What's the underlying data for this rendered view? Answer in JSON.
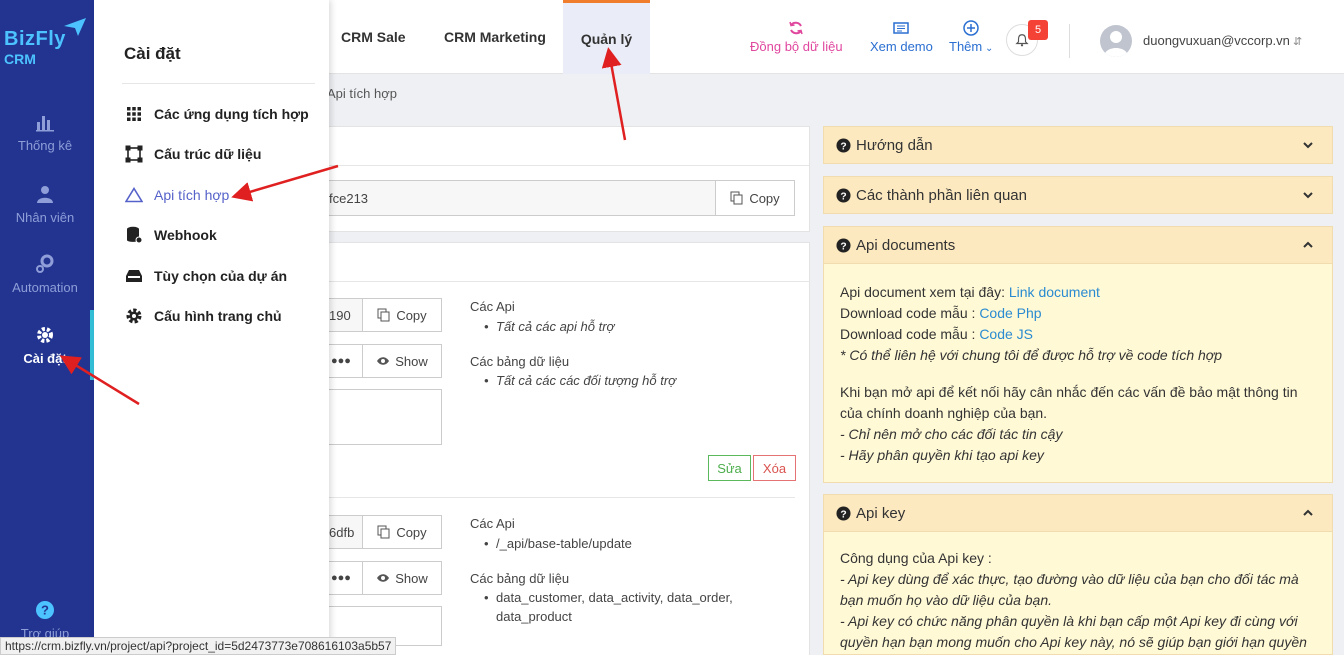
{
  "logo": {
    "line1": "BizFly",
    "line2": "CRM"
  },
  "rail": {
    "items": [
      {
        "label": "Thống kê"
      },
      {
        "label": "Nhân viên"
      },
      {
        "label": "Automation"
      },
      {
        "label": "Cài đặt"
      },
      {
        "label": "Trợ giúp"
      }
    ]
  },
  "panel": {
    "title": "Cài đặt",
    "items": [
      {
        "label": "Các ứng dụng tích hợp"
      },
      {
        "label": "Cấu trúc dữ liệu"
      },
      {
        "label": "Api tích hợp"
      },
      {
        "label": "Webhook"
      },
      {
        "label": "Tùy chọn của dự án"
      },
      {
        "label": "Cấu hình trang chủ"
      }
    ]
  },
  "nav": {
    "tabs": [
      {
        "label": "CRM Sale"
      },
      {
        "label": "CRM Marketing"
      },
      {
        "label": "Quản lý"
      }
    ],
    "sync_label": "Đồng bộ dữ liệu",
    "demo_label": "Xem demo",
    "more_label": "Thêm",
    "notification_count": "5",
    "user_email": "duongvuxuan@vccorp.vn"
  },
  "breadcrumb": "Api tích hợp",
  "main": {
    "project_key_value": "fce213",
    "copy_label": "Copy",
    "show_label": "Show",
    "key1": {
      "value": "190",
      "password": "●●●",
      "apis_label": "Các Api",
      "apis": [
        "Tất cả các api hỗ trợ"
      ],
      "tables_label": "Các bảng dữ liệu",
      "tables": [
        "Tất cả các các đối tượng hỗ trợ"
      ]
    },
    "edit_label": "Sửa",
    "delete_label": "Xóa",
    "key2": {
      "value": "6dfb",
      "password": "●●●",
      "apis_label": "Các Api",
      "apis": [
        "/_api/base-table/update"
      ],
      "tables_label": "Các bảng dữ liệu",
      "tables_line1": "data_customer, data_activity, data_order,",
      "tables_line2": "data_product"
    }
  },
  "right": {
    "guide": "Hướng dẫn",
    "related": "Các thành phần liên quan",
    "api_docs": {
      "title": "Api documents",
      "l1_text": "Api document xem tại đây: ",
      "l1_link": "Link document",
      "l2_text": "Download code mẫu : ",
      "l2_link": "Code Php",
      "l3_text": "Download code mẫu : ",
      "l3_link": "Code JS",
      "l4": "* Có thể liên hệ với chung tôi để được hỗ trợ về code tích hợp",
      "p1": "Khi bạn mở api để kết nối hãy cân nhắc đến các vấn đề bảo mật thông tin của chính doanh nghiệp của bạn.",
      "p2": "- Chỉ nên mở cho các đối tác tin cậy",
      "p3": "- Hãy phân quyền khi tạo api key"
    },
    "api_key": {
      "title": "Api key",
      "l1": "Công dụng của Api key :",
      "l2": "- Api key dùng để xác thực, tạo đường vào dữ liệu của bạn cho đối tác mà bạn muốn họ vào dữ liệu của bạn.",
      "l3": "- Api key có chức năng phân quyền là khi bạn cấp một Api key đi cùng với quyền hạn bạn mong muốn cho Api key này, nó sẽ giúp bạn giới hạn quyền"
    }
  },
  "status_url": "https://crm.bizfly.vn/project/api?project_id=5d2473773e708616103a5b57",
  "colors": {
    "rail": "#223490",
    "accent": "#f07d2c",
    "active_menu": "#5562c9",
    "arrow": "#e02020"
  }
}
